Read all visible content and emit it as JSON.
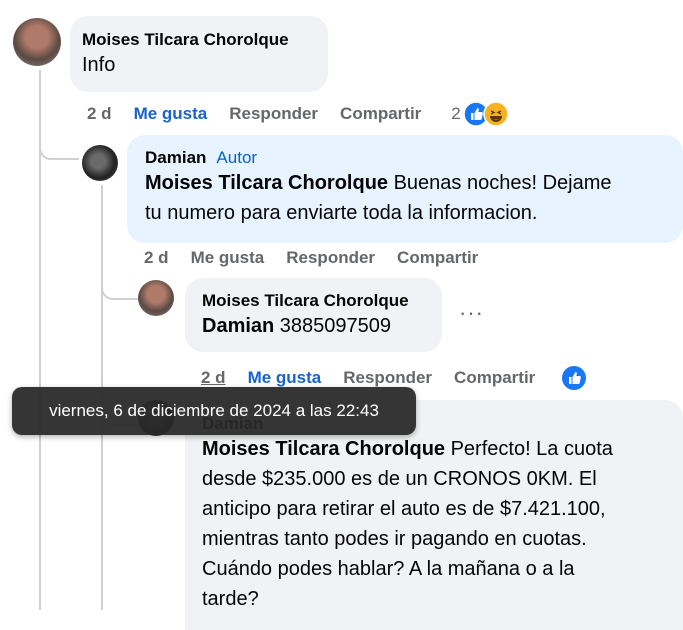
{
  "comments": [
    {
      "author": "Moises Tilcara Chorolque",
      "text": "Info",
      "actions": {
        "time": "2 d",
        "like": "Me gusta",
        "reply": "Responder",
        "share": "Compartir"
      },
      "reaction_count": "2"
    },
    {
      "author": "Damian",
      "badge": "Autor",
      "mention": "Moises Tilcara Chorolque",
      "text_line1": " Buenas noches! Dejame",
      "text_line2": "tu numero para enviarte toda la informacion.",
      "actions": {
        "time": "2 d",
        "like": "Me gusta",
        "reply": "Responder",
        "share": "Compartir"
      }
    },
    {
      "author": "Moises Tilcara Chorolque",
      "mention": "Damian",
      "text": " 3885097509",
      "more": "···",
      "actions": {
        "time": "2 d",
        "like": "Me gusta",
        "reply": "Responder",
        "share": "Compartir"
      }
    },
    {
      "author": "Damian",
      "mention": "Moises Tilcara Chorolque",
      "text_line1": " Perfecto! La cuota",
      "text_line2": "desde $235.000 es de un CRONOS 0KM. El",
      "text_line3": "anticipo para retirar el auto es de $7.421.100,",
      "text_line4": "mientras tanto podes ir pagando en cuotas.",
      "text_line5": "Cuándo podes hablar? A la mañana o a la",
      "text_line6": "tarde?"
    }
  ],
  "tooltip": "viernes, 6 de diciembre de 2024 a las 22:43",
  "colors": {
    "like_blue": "#1763cf",
    "bubble_gray": "#f0f2f5",
    "bubble_blue": "#e7f3ff"
  }
}
